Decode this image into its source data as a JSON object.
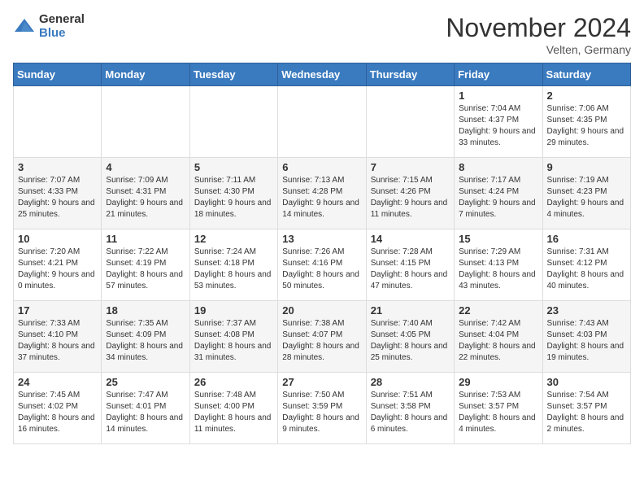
{
  "logo": {
    "general": "General",
    "blue": "Blue"
  },
  "header": {
    "month": "November 2024",
    "location": "Velten, Germany"
  },
  "weekdays": [
    "Sunday",
    "Monday",
    "Tuesday",
    "Wednesday",
    "Thursday",
    "Friday",
    "Saturday"
  ],
  "weeks": [
    [
      {
        "day": "",
        "info": ""
      },
      {
        "day": "",
        "info": ""
      },
      {
        "day": "",
        "info": ""
      },
      {
        "day": "",
        "info": ""
      },
      {
        "day": "",
        "info": ""
      },
      {
        "day": "1",
        "info": "Sunrise: 7:04 AM\nSunset: 4:37 PM\nDaylight: 9 hours\nand 33 minutes."
      },
      {
        "day": "2",
        "info": "Sunrise: 7:06 AM\nSunset: 4:35 PM\nDaylight: 9 hours\nand 29 minutes."
      }
    ],
    [
      {
        "day": "3",
        "info": "Sunrise: 7:07 AM\nSunset: 4:33 PM\nDaylight: 9 hours\nand 25 minutes."
      },
      {
        "day": "4",
        "info": "Sunrise: 7:09 AM\nSunset: 4:31 PM\nDaylight: 9 hours\nand 21 minutes."
      },
      {
        "day": "5",
        "info": "Sunrise: 7:11 AM\nSunset: 4:30 PM\nDaylight: 9 hours\nand 18 minutes."
      },
      {
        "day": "6",
        "info": "Sunrise: 7:13 AM\nSunset: 4:28 PM\nDaylight: 9 hours\nand 14 minutes."
      },
      {
        "day": "7",
        "info": "Sunrise: 7:15 AM\nSunset: 4:26 PM\nDaylight: 9 hours\nand 11 minutes."
      },
      {
        "day": "8",
        "info": "Sunrise: 7:17 AM\nSunset: 4:24 PM\nDaylight: 9 hours\nand 7 minutes."
      },
      {
        "day": "9",
        "info": "Sunrise: 7:19 AM\nSunset: 4:23 PM\nDaylight: 9 hours\nand 4 minutes."
      }
    ],
    [
      {
        "day": "10",
        "info": "Sunrise: 7:20 AM\nSunset: 4:21 PM\nDaylight: 9 hours\nand 0 minutes."
      },
      {
        "day": "11",
        "info": "Sunrise: 7:22 AM\nSunset: 4:19 PM\nDaylight: 8 hours\nand 57 minutes."
      },
      {
        "day": "12",
        "info": "Sunrise: 7:24 AM\nSunset: 4:18 PM\nDaylight: 8 hours\nand 53 minutes."
      },
      {
        "day": "13",
        "info": "Sunrise: 7:26 AM\nSunset: 4:16 PM\nDaylight: 8 hours\nand 50 minutes."
      },
      {
        "day": "14",
        "info": "Sunrise: 7:28 AM\nSunset: 4:15 PM\nDaylight: 8 hours\nand 47 minutes."
      },
      {
        "day": "15",
        "info": "Sunrise: 7:29 AM\nSunset: 4:13 PM\nDaylight: 8 hours\nand 43 minutes."
      },
      {
        "day": "16",
        "info": "Sunrise: 7:31 AM\nSunset: 4:12 PM\nDaylight: 8 hours\nand 40 minutes."
      }
    ],
    [
      {
        "day": "17",
        "info": "Sunrise: 7:33 AM\nSunset: 4:10 PM\nDaylight: 8 hours\nand 37 minutes."
      },
      {
        "day": "18",
        "info": "Sunrise: 7:35 AM\nSunset: 4:09 PM\nDaylight: 8 hours\nand 34 minutes."
      },
      {
        "day": "19",
        "info": "Sunrise: 7:37 AM\nSunset: 4:08 PM\nDaylight: 8 hours\nand 31 minutes."
      },
      {
        "day": "20",
        "info": "Sunrise: 7:38 AM\nSunset: 4:07 PM\nDaylight: 8 hours\nand 28 minutes."
      },
      {
        "day": "21",
        "info": "Sunrise: 7:40 AM\nSunset: 4:05 PM\nDaylight: 8 hours\nand 25 minutes."
      },
      {
        "day": "22",
        "info": "Sunrise: 7:42 AM\nSunset: 4:04 PM\nDaylight: 8 hours\nand 22 minutes."
      },
      {
        "day": "23",
        "info": "Sunrise: 7:43 AM\nSunset: 4:03 PM\nDaylight: 8 hours\nand 19 minutes."
      }
    ],
    [
      {
        "day": "24",
        "info": "Sunrise: 7:45 AM\nSunset: 4:02 PM\nDaylight: 8 hours\nand 16 minutes."
      },
      {
        "day": "25",
        "info": "Sunrise: 7:47 AM\nSunset: 4:01 PM\nDaylight: 8 hours\nand 14 minutes."
      },
      {
        "day": "26",
        "info": "Sunrise: 7:48 AM\nSunset: 4:00 PM\nDaylight: 8 hours\nand 11 minutes."
      },
      {
        "day": "27",
        "info": "Sunrise: 7:50 AM\nSunset: 3:59 PM\nDaylight: 8 hours\nand 9 minutes."
      },
      {
        "day": "28",
        "info": "Sunrise: 7:51 AM\nSunset: 3:58 PM\nDaylight: 8 hours\nand 6 minutes."
      },
      {
        "day": "29",
        "info": "Sunrise: 7:53 AM\nSunset: 3:57 PM\nDaylight: 8 hours\nand 4 minutes."
      },
      {
        "day": "30",
        "info": "Sunrise: 7:54 AM\nSunset: 3:57 PM\nDaylight: 8 hours\nand 2 minutes."
      }
    ]
  ]
}
